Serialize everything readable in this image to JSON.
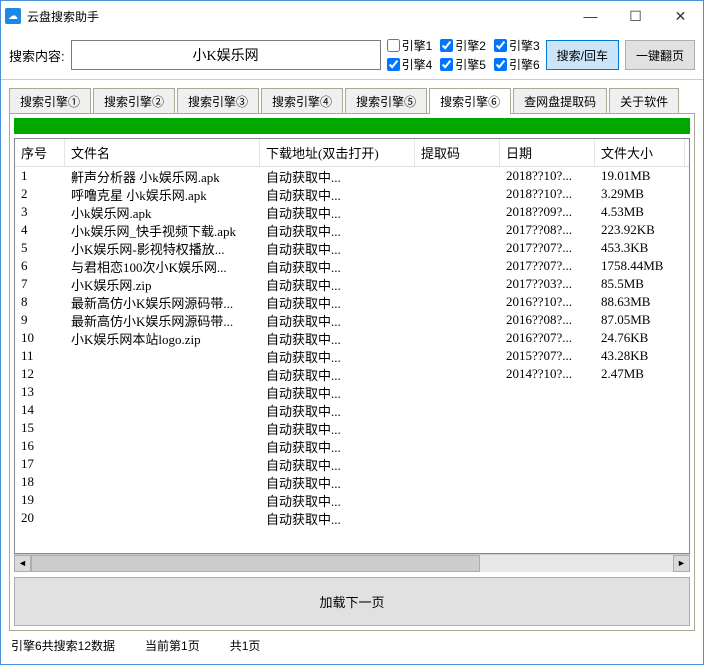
{
  "window": {
    "title": "云盘搜索助手"
  },
  "search": {
    "label": "搜索内容:",
    "value": "小K娱乐网",
    "engines": [
      {
        "label": "引擎1",
        "checked": false
      },
      {
        "label": "引擎2",
        "checked": true
      },
      {
        "label": "引擎3",
        "checked": true
      },
      {
        "label": "引擎4",
        "checked": true
      },
      {
        "label": "引擎5",
        "checked": true
      },
      {
        "label": "引擎6",
        "checked": true
      }
    ],
    "search_btn": "搜索/回车",
    "page_btn": "一键翻页"
  },
  "tabs": {
    "items": [
      "搜索引擎①",
      "搜索引擎②",
      "搜索引擎③",
      "搜索引擎④",
      "搜索引擎⑤",
      "搜索引擎⑥",
      "查网盘提取码",
      "关于软件"
    ],
    "active": 5
  },
  "table": {
    "headers": [
      "序号",
      "文件名",
      "下载地址(双击打开)",
      "提取码",
      "日期",
      "文件大小"
    ],
    "rows": [
      {
        "n": "1",
        "name": "鼾声分析器 小k娱乐网.apk",
        "dl": "自动获取中...",
        "code": "",
        "date": "2018??10?...",
        "size": "19.01MB"
      },
      {
        "n": "2",
        "name": "呼噜克星 小k娱乐网.apk",
        "dl": "自动获取中...",
        "code": "",
        "date": "2018??10?...",
        "size": "3.29MB"
      },
      {
        "n": "3",
        "name": "小k娱乐网.apk",
        "dl": "自动获取中...",
        "code": "",
        "date": "2018??09?...",
        "size": "4.53MB"
      },
      {
        "n": "4",
        "name": "小k娱乐网_快手视频下载.apk",
        "dl": "自动获取中...",
        "code": "",
        "date": "2017??08?...",
        "size": "223.92KB"
      },
      {
        "n": "5",
        "name": "小K娱乐网-影视特权播放...",
        "dl": "自动获取中...",
        "code": "",
        "date": "2017??07?...",
        "size": "453.3KB"
      },
      {
        "n": "6",
        "name": "与君相恋100次小K娱乐网...",
        "dl": "自动获取中...",
        "code": "",
        "date": "2017??07?...",
        "size": "1758.44MB"
      },
      {
        "n": "7",
        "name": "小K娱乐网.zip",
        "dl": "自动获取中...",
        "code": "",
        "date": "2017??03?...",
        "size": "85.5MB"
      },
      {
        "n": "8",
        "name": "最新高仿小K娱乐网源码带...",
        "dl": "自动获取中...",
        "code": "",
        "date": "2016??10?...",
        "size": "88.63MB"
      },
      {
        "n": "9",
        "name": "最新高仿小K娱乐网源码带...",
        "dl": "自动获取中...",
        "code": "",
        "date": "2016??08?...",
        "size": "87.05MB"
      },
      {
        "n": "10",
        "name": "小K娱乐网本站logo.zip",
        "dl": "自动获取中...",
        "code": "",
        "date": "2016??07?...",
        "size": "24.76KB"
      },
      {
        "n": "11",
        "name": "",
        "dl": "自动获取中...",
        "code": "",
        "date": "2015??07?...",
        "size": "43.28KB"
      },
      {
        "n": "12",
        "name": "",
        "dl": "自动获取中...",
        "code": "",
        "date": "2014??10?...",
        "size": "2.47MB"
      },
      {
        "n": "13",
        "name": "",
        "dl": "自动获取中...",
        "code": "",
        "date": "",
        "size": ""
      },
      {
        "n": "14",
        "name": "",
        "dl": "自动获取中...",
        "code": "",
        "date": "",
        "size": ""
      },
      {
        "n": "15",
        "name": "",
        "dl": "自动获取中...",
        "code": "",
        "date": "",
        "size": ""
      },
      {
        "n": "16",
        "name": "",
        "dl": "自动获取中...",
        "code": "",
        "date": "",
        "size": ""
      },
      {
        "n": "17",
        "name": "",
        "dl": "自动获取中...",
        "code": "",
        "date": "",
        "size": ""
      },
      {
        "n": "18",
        "name": "",
        "dl": "自动获取中...",
        "code": "",
        "date": "",
        "size": ""
      },
      {
        "n": "19",
        "name": "",
        "dl": "自动获取中...",
        "code": "",
        "date": "",
        "size": ""
      },
      {
        "n": "20",
        "name": "",
        "dl": "自动获取中...",
        "code": "",
        "date": "",
        "size": ""
      }
    ]
  },
  "loadmore": "加载下一页",
  "status": {
    "result": "引擎6共搜索12数据",
    "page": "当前第1页",
    "total": "共1页"
  }
}
